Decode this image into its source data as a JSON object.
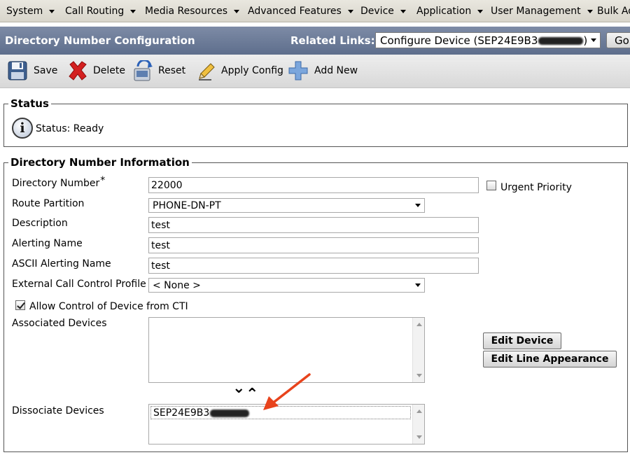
{
  "menu": {
    "items": [
      {
        "label": "System"
      },
      {
        "label": "Call Routing"
      },
      {
        "label": "Media Resources"
      },
      {
        "label": "Advanced Features"
      },
      {
        "label": "Device"
      },
      {
        "label": "Application"
      },
      {
        "label": "User Management"
      },
      {
        "label": "Bulk Ad"
      }
    ]
  },
  "header": {
    "title": "Directory Number Configuration",
    "related_links_label": "Related Links:",
    "related_links_value": "Configure Device (SEP24E9B3",
    "related_links_value_end": ")",
    "go_label": "Go"
  },
  "toolbar": {
    "save_label": "Save",
    "delete_label": "Delete",
    "reset_label": "Reset",
    "apply_config_label": "Apply Config",
    "add_new_label": "Add New"
  },
  "status": {
    "legend": "Status",
    "text": "Status: Ready"
  },
  "dn_info": {
    "legend": "Directory Number Information",
    "directory_number_label": "Directory Number",
    "required_mark": "*",
    "directory_number_value": "22000",
    "urgent_priority_label": "Urgent Priority",
    "urgent_priority_checked": false,
    "route_partition_label": "Route Partition",
    "route_partition_value": "PHONE-DN-PT",
    "description_label": "Description",
    "description_value": "test",
    "alerting_name_label": "Alerting Name",
    "alerting_name_value": "test",
    "ascii_alerting_name_label": "ASCII Alerting Name",
    "ascii_alerting_name_value": "test",
    "external_call_control_label": "External Call Control Profile",
    "external_call_control_value": "< None >",
    "allow_cti_label": "Allow Control of Device from CTI",
    "allow_cti_checked": true,
    "associated_devices_label": "Associated Devices",
    "edit_device_label": "Edit Device",
    "edit_line_appearance_label": "Edit Line Appearance",
    "move_down_glyph": "⌄",
    "move_up_glyph": "⌃",
    "dissociate_devices_label": "Dissociate Devices",
    "dissociate_device_item": "SEP24E9B3"
  },
  "colors": {
    "title_bar": "#6e7d9a",
    "annotation_arrow": "#e8431c"
  }
}
